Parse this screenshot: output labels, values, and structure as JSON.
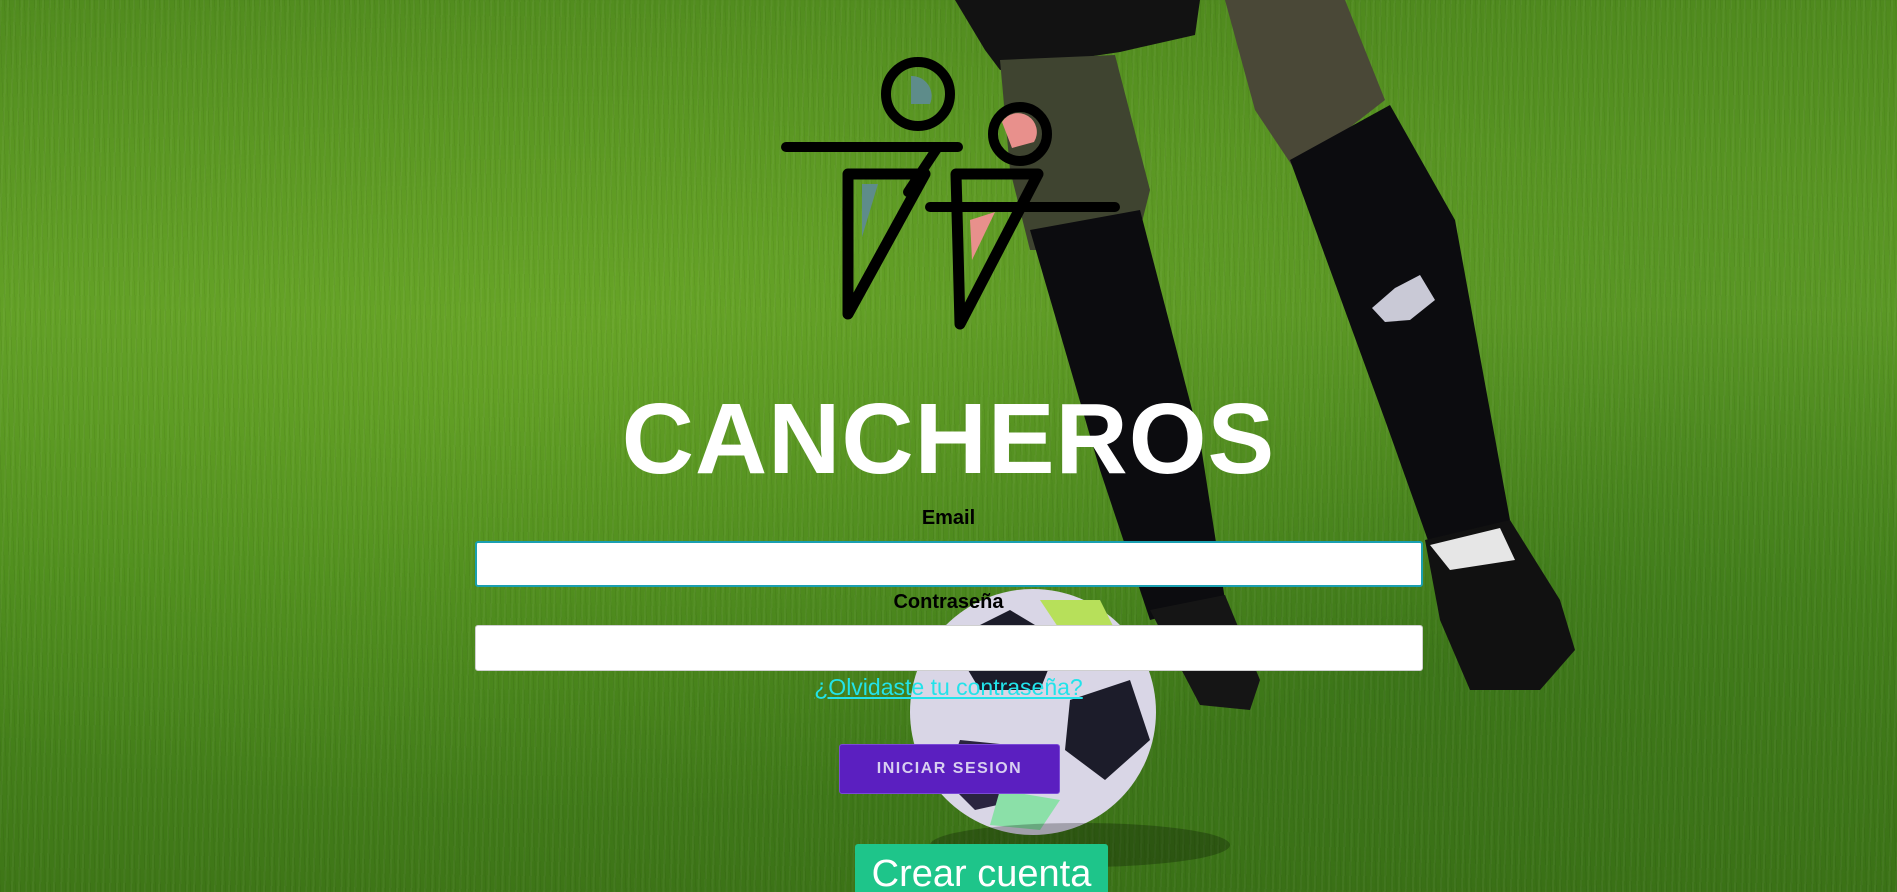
{
  "brand": {
    "title": "CANCHEROS",
    "colors": {
      "figure_stroke": "#000000",
      "figure_left_fill": "#5e8c8a",
      "figure_right_fill": "#e8908c"
    }
  },
  "form": {
    "email_label": "Email",
    "email_value": "",
    "password_label": "Contraseña",
    "password_value": "",
    "forgot_link": "¿Olvidaste tu contraseña?",
    "login_button": "INICIAR SESION",
    "create_button": "Crear cuenta"
  },
  "colors": {
    "background": "#4f8a1e",
    "link": "#22e3ea",
    "login_button": "#5b1fc0",
    "create_button": "#1ec58a",
    "focus_border": "#1a9fb0"
  }
}
